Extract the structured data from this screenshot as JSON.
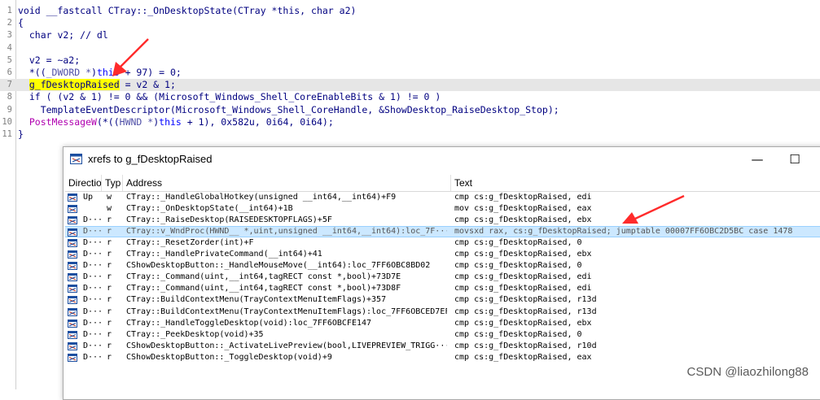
{
  "code": {
    "lines": [
      {
        "n": "1",
        "parts": [
          {
            "t": "void __fastcall CTray::_OnDesktopState(CTray *this, char a2)",
            "c": "c-fn"
          }
        ]
      },
      {
        "n": "2",
        "parts": [
          {
            "t": "{",
            "c": "c-fn"
          }
        ]
      },
      {
        "n": "3",
        "parts": [
          {
            "t": "  char v2; // dl",
            "c": "c-fn"
          }
        ]
      },
      {
        "n": "4",
        "parts": [
          {
            "t": "",
            "c": "c-fn"
          }
        ]
      },
      {
        "n": "5",
        "parts": [
          {
            "t": "  v2 = ~a2;",
            "c": "c-fn"
          }
        ]
      },
      {
        "n": "6",
        "parts": [
          {
            "t": "  *((",
            "c": "c-fn"
          },
          {
            "t": "_DWORD *",
            "c": "c-cast"
          },
          {
            "t": ")",
            "c": "c-fn"
          },
          {
            "t": "this",
            "c": "c-kw"
          },
          {
            "t": " + 97) = 0;",
            "c": "c-fn"
          }
        ]
      },
      {
        "n": "7",
        "parts": [
          {
            "t": "  ",
            "c": "c-fn"
          },
          {
            "t": "g_fDesktopRaised",
            "c": "c-tgt"
          },
          {
            "t": " = v2 & 1;",
            "c": "c-fn"
          }
        ],
        "hl": true
      },
      {
        "n": "8",
        "parts": [
          {
            "t": "  if ( (v2 & 1) != 0 && (Microsoft_Windows_Shell_CoreEnableBits & 1) != 0 )",
            "c": "c-fn"
          }
        ]
      },
      {
        "n": "9",
        "parts": [
          {
            "t": "    TemplateEventDescriptor(Microsoft_Windows_Shell_CoreHandle, &ShowDesktop_RaiseDesktop_Stop);",
            "c": "c-fn"
          }
        ]
      },
      {
        "n": "10",
        "parts": [
          {
            "t": "  ",
            "c": "c-fn"
          },
          {
            "t": "PostMessageW",
            "c": "c-mag"
          },
          {
            "t": "(*((",
            "c": "c-fn"
          },
          {
            "t": "HWND *",
            "c": "c-cast"
          },
          {
            "t": ")",
            "c": "c-fn"
          },
          {
            "t": "this",
            "c": "c-kw"
          },
          {
            "t": " + 1), 0x582u, 0i64, 0i64);",
            "c": "c-fn"
          }
        ]
      },
      {
        "n": "11",
        "parts": [
          {
            "t": "}",
            "c": "c-fn"
          }
        ]
      }
    ]
  },
  "xrefs_window": {
    "title": "xrefs to g_fDesktopRaised",
    "minimize": "—",
    "maximize": "☐",
    "close": "✕",
    "icon": "table-icon",
    "columns": [
      "Directio",
      "Typ",
      "Address",
      "Text"
    ],
    "rows": [
      {
        "dir": "Up",
        "type": "w",
        "address": "CTray::_HandleGlobalHotkey(unsigned __int64,__int64)+F9",
        "text": "cmp     cs:g_fDesktopRaised, edi"
      },
      {
        "dir": "",
        "type": "w",
        "address": "CTray::_OnDesktopState(__int64)+1B",
        "text": "mov     cs:g_fDesktopRaised, eax"
      },
      {
        "dir": "D···",
        "type": "r",
        "address": "CTray::_RaiseDesktop(RAISEDESKTOPFLAGS)+5F",
        "text": "cmp     cs:g_fDesktopRaised, ebx"
      },
      {
        "dir": "D···",
        "type": "r",
        "address": "CTray::v_WndProc(HWND__ *,uint,unsigned __int64,__int64):loc_7F···",
        "text": "movsxd  rax, cs:g_fDesktopRaised; jumptable 00007FF6OBC2D5BC case 1478",
        "selected": true
      },
      {
        "dir": "D···",
        "type": "r",
        "address": "CTray::_ResetZorder(int)+F",
        "text": "cmp     cs:g_fDesktopRaised, 0"
      },
      {
        "dir": "D···",
        "type": "r",
        "address": "CTray::_HandlePrivateCommand(__int64)+41",
        "text": "cmp     cs:g_fDesktopRaised, ebx"
      },
      {
        "dir": "D···",
        "type": "r",
        "address": "CShowDesktopButton::_HandleMouseMove(__int64):loc_7FF6OBC8BD02",
        "text": "cmp     cs:g_fDesktopRaised, 0"
      },
      {
        "dir": "D···",
        "type": "r",
        "address": "CTray::_Command(uint,__int64,tagRECT const *,bool)+73D7E",
        "text": "cmp     cs:g_fDesktopRaised, edi"
      },
      {
        "dir": "D···",
        "type": "r",
        "address": "CTray::_Command(uint,__int64,tagRECT const *,bool)+73D8F",
        "text": "cmp     cs:g_fDesktopRaised, edi"
      },
      {
        "dir": "D···",
        "type": "r",
        "address": "CTray::BuildContextMenu(TrayContextMenuItemFlags)+357",
        "text": "cmp     cs:g_fDesktopRaised, r13d"
      },
      {
        "dir": "D···",
        "type": "r",
        "address": "CTray::BuildContextMenu(TrayContextMenuItemFlags):loc_7FF6OBCED7EF",
        "text": "cmp     cs:g_fDesktopRaised, r13d"
      },
      {
        "dir": "D···",
        "type": "r",
        "address": "CTray::_HandleToggleDesktop(void):loc_7FF6OBCFE147",
        "text": "cmp     cs:g_fDesktopRaised, ebx"
      },
      {
        "dir": "D···",
        "type": "r",
        "address": "CTray::_PeekDesktop(void)+35",
        "text": "cmp     cs:g_fDesktopRaised, 0"
      },
      {
        "dir": "D···",
        "type": "r",
        "address": "CShowDesktopButton::_ActivateLivePreview(bool,LIVEPREVIEW_TRIGG···",
        "text": "cmp     cs:g_fDesktopRaised, r10d"
      },
      {
        "dir": "D···",
        "type": "r",
        "address": "CShowDesktopButton::_ToggleDesktop(void)+9",
        "text": "cmp     cs:g_fDesktopRaised, eax"
      }
    ]
  },
  "watermark": "CSDN @liaozhilong88",
  "colors": {
    "arrow": "#ff2b2b",
    "selection": "#cce8ff",
    "highlight": "#ffff00"
  }
}
